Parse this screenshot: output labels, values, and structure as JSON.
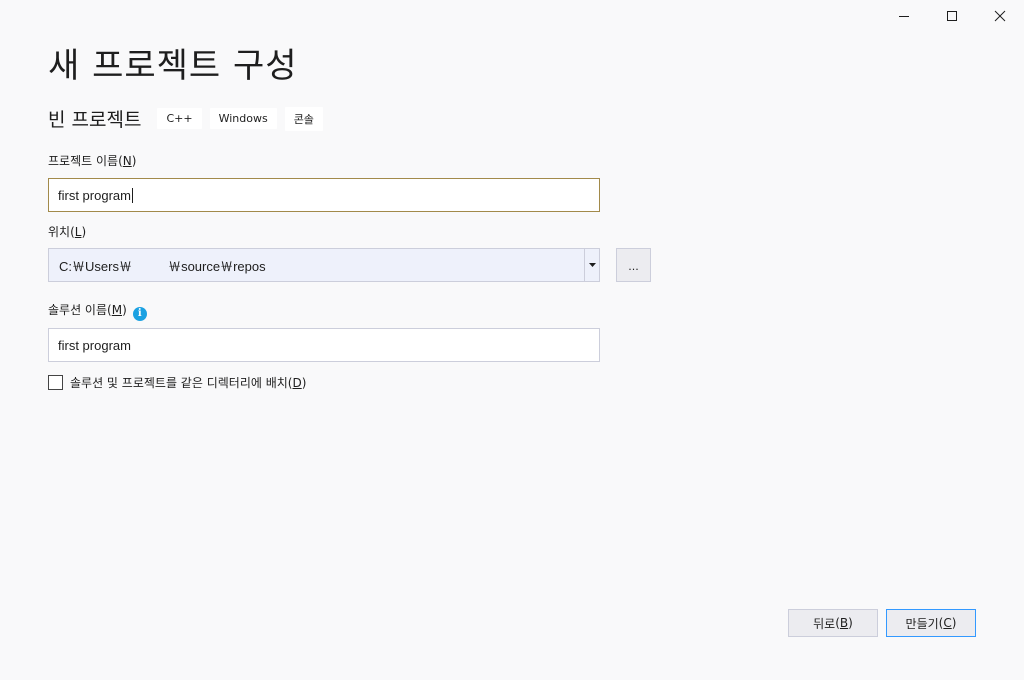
{
  "window": {
    "minimize_icon": "minimize-icon",
    "maximize_icon": "maximize-icon",
    "close_icon": "close-icon"
  },
  "page_title": "새 프로젝트 구성",
  "template": {
    "name": "빈 프로젝트",
    "tags": [
      "C++",
      "Windows",
      "콘솔"
    ]
  },
  "project_name": {
    "label": "프로젝트 이름",
    "accel": "N",
    "value": "first program"
  },
  "location": {
    "label": "위치",
    "accel": "L",
    "value": "C:￦Users￦          ￦source￦repos",
    "browse_label": "..."
  },
  "solution_name": {
    "label": "솔루션 이름",
    "accel": "M",
    "info_icon": "info-icon",
    "value": "first program"
  },
  "same_dir": {
    "label": "솔루션 및 프로젝트를 같은 디렉터리에 배치",
    "accel": "D",
    "checked": false
  },
  "buttons": {
    "back": {
      "label": "뒤로",
      "accel": "B"
    },
    "create": {
      "label": "만들기",
      "accel": "C"
    }
  },
  "colors": {
    "focus_border": "#a28a4a",
    "default_button_border": "#3399ff",
    "info": "#1ba1e2"
  }
}
